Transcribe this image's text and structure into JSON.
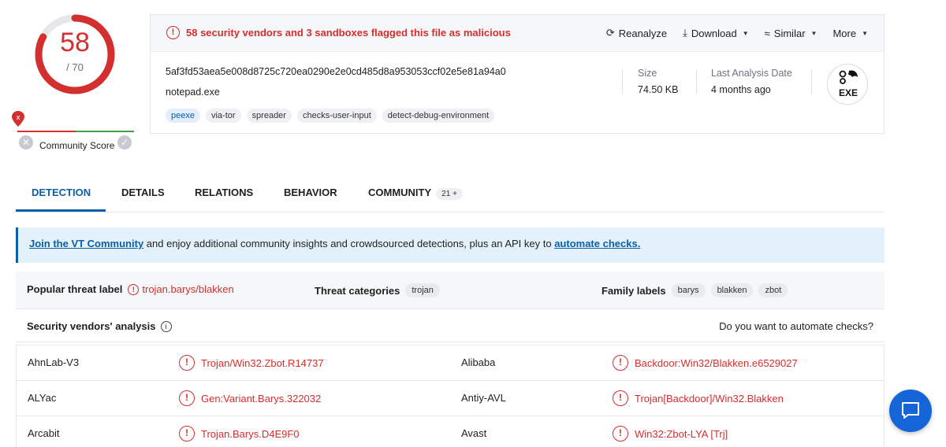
{
  "score": {
    "positives": "58",
    "total": "/ 70",
    "ratio": 0.8286
  },
  "community": {
    "label": "Community Score"
  },
  "alert": {
    "text": "58 security vendors and 3 sandboxes flagged this file as malicious"
  },
  "actions": {
    "reanalyze": "Reanalyze",
    "download": "Download",
    "similar": "Similar",
    "more": "More"
  },
  "file": {
    "hash": "5af3fd53aea5e008d8725c720ea0290e2e0cd485d8a953053ccf02e5e81a94a0",
    "name": "notepad.exe",
    "tags": [
      "peexe",
      "via-tor",
      "spreader",
      "checks-user-input",
      "detect-debug-environment"
    ],
    "size_label": "Size",
    "size_value": "74.50 KB",
    "date_label": "Last Analysis Date",
    "date_value": "4 months ago",
    "type_label": "EXE"
  },
  "tabs": {
    "detection": "DETECTION",
    "details": "DETAILS",
    "relations": "RELATIONS",
    "behavior": "BEHAVIOR",
    "community": "COMMUNITY",
    "community_count": "21 +"
  },
  "banner": {
    "link1": "Join the VT Community",
    "middle": " and enjoy additional community insights and crowdsourced detections, plus an API key to ",
    "link2": "automate checks."
  },
  "threat": {
    "popular_label": "Popular threat label",
    "popular_value": "trojan.barys/blakken",
    "categories_label": "Threat categories",
    "categories": [
      "trojan"
    ],
    "family_label": "Family labels",
    "families": [
      "barys",
      "blakken",
      "zbot"
    ]
  },
  "vendors_header": {
    "title": "Security vendors' analysis",
    "automate": "Do you want to automate checks?"
  },
  "vendors": [
    {
      "v1": "AhnLab-V3",
      "d1": "Trojan/Win32.Zbot.R14737",
      "v2": "Alibaba",
      "d2": "Backdoor:Win32/Blakken.e6529027"
    },
    {
      "v1": "ALYac",
      "d1": "Gen:Variant.Barys.322032",
      "v2": "Antiy-AVL",
      "d2": "Trojan[Backdoor]/Win32.Blakken"
    },
    {
      "v1": "Arcabit",
      "d1": "Trojan.Barys.D4E9F0",
      "v2": "Avast",
      "d2": "Win32:Zbot-LYA [Trj]"
    }
  ],
  "colors": {
    "malicious": "#d32f2f",
    "accent": "#0b5fa8",
    "fab": "#1565d8"
  }
}
